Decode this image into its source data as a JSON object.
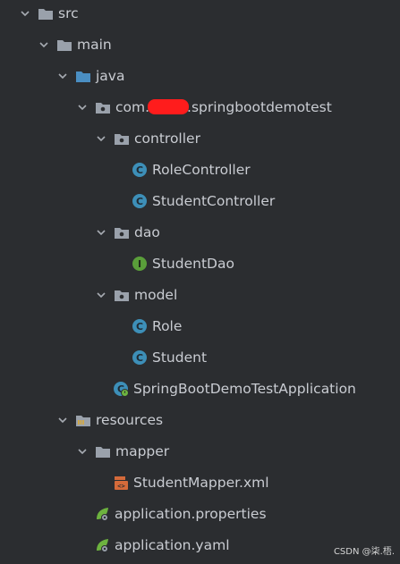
{
  "tree": {
    "src": "src",
    "main": "main",
    "java": "java",
    "package_prefix": "com.",
    "package_suffix": ".springbootdemotest",
    "controller": "controller",
    "role_controller": "RoleController",
    "student_controller": "StudentController",
    "dao": "dao",
    "student_dao": "StudentDao",
    "model": "model",
    "role": "Role",
    "student": "Student",
    "app_class": "SpringBootDemoTestApplication",
    "resources": "resources",
    "mapper": "mapper",
    "mapper_xml": "StudentMapper.xml",
    "app_properties": "application.properties",
    "app_yaml": "application.yaml"
  },
  "watermark": "CSDN @柒.梧.",
  "colors": {
    "background": "#2b2d30",
    "text": "#c9ccd2",
    "folder": "#9aa1ab",
    "java_folder": "#4a8ec2",
    "class_icon": "#3d8fb8",
    "interface_icon": "#5a9e3a",
    "spring_leaf": "#6db33f",
    "xml_icon": "#d46a3a",
    "redaction": "#ff1c1c"
  },
  "icons": {
    "chevron": "chevron-down-icon",
    "folder": "folder-icon",
    "package": "package-icon",
    "class": "class-icon",
    "interface": "interface-icon",
    "spring_boot_app": "spring-boot-app-icon",
    "resources_folder": "resources-folder-icon",
    "xml": "xml-file-icon",
    "spring_config": "spring-config-icon"
  }
}
